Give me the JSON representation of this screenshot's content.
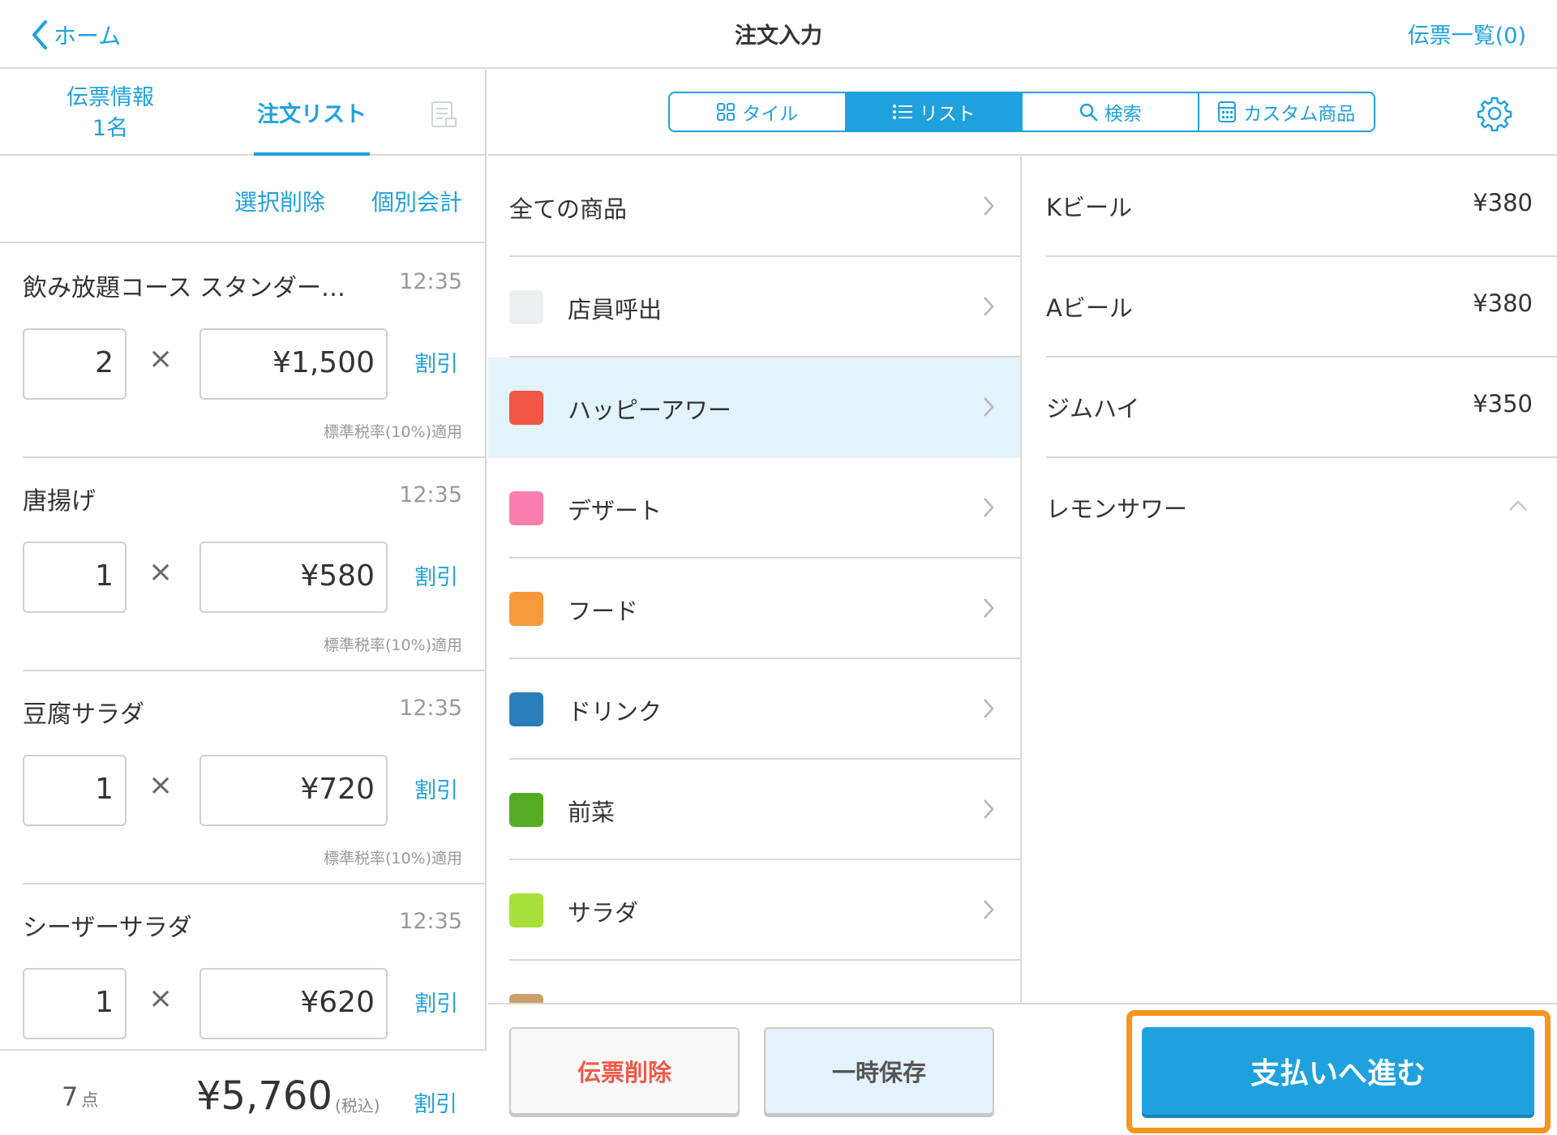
{
  "header": {
    "back_label": "ホーム",
    "title": "注文入力",
    "slip_list_label": "伝票一覧(0)"
  },
  "left_tabs": {
    "slip_info_label": "伝票情報",
    "slip_info_guests": "1名",
    "order_list_label": "注文リスト"
  },
  "left_actions": {
    "bulk_delete_label": "選択削除",
    "split_pay_label": "個別会計"
  },
  "orders": [
    {
      "name": "飲み放題コース スタンダー…",
      "time": "12:35",
      "qty": "2",
      "price": "¥1,500",
      "discount": "割引",
      "tax": "標準税率(10%)適用"
    },
    {
      "name": "唐揚げ",
      "time": "12:35",
      "qty": "1",
      "price": "¥580",
      "discount": "割引",
      "tax": "標準税率(10%)適用"
    },
    {
      "name": "豆腐サラダ",
      "time": "12:35",
      "qty": "1",
      "price": "¥720",
      "discount": "割引",
      "tax": "標準税率(10%)適用"
    },
    {
      "name": "シーザーサラダ",
      "time": "12:35",
      "qty": "1",
      "price": "¥620",
      "discount": "割引",
      "tax": ""
    }
  ],
  "multiply_sign": "×",
  "footer": {
    "count": "7",
    "count_unit": "点",
    "total": "¥5,760",
    "tax_note": "(税込)",
    "discount_label": "割引"
  },
  "segments": [
    {
      "label": "タイル",
      "icon": "tile-grid-icon",
      "active": false
    },
    {
      "label": "リスト",
      "icon": "list-icon",
      "active": true
    },
    {
      "label": "検索",
      "icon": "search-icon",
      "active": false
    },
    {
      "label": "カスタム商品",
      "icon": "calculator-icon",
      "active": false
    }
  ],
  "categories": [
    {
      "label": "全ての商品",
      "color": null,
      "selected": false
    },
    {
      "label": "店員呼出",
      "color": "#eceff0",
      "selected": false
    },
    {
      "label": "ハッピーアワー",
      "color": "#f05545",
      "selected": true
    },
    {
      "label": "デザート",
      "color": "#f980ae",
      "selected": false
    },
    {
      "label": "フード",
      "color": "#f7993a",
      "selected": false
    },
    {
      "label": "ドリンク",
      "color": "#2a7fba",
      "selected": false
    },
    {
      "label": "前菜",
      "color": "#57ab24",
      "selected": false
    },
    {
      "label": "サラダ",
      "color": "#a8e03a",
      "selected": false
    },
    {
      "label": "",
      "color": "#c9a06b",
      "selected": false
    }
  ],
  "products": [
    {
      "name": "Kビール",
      "price": "¥380"
    },
    {
      "name": "Aビール",
      "price": "¥380"
    },
    {
      "name": "ジムハイ",
      "price": "¥350"
    },
    {
      "name": "レモンサワー",
      "price": ""
    }
  ],
  "bottom_actions": {
    "delete_slip_label": "伝票削除",
    "temp_save_label": "一時保存",
    "pay_label": "支払いへ進む"
  },
  "colors": {
    "accent": "#1fa1dd",
    "highlight": "#f7941d",
    "danger": "#ef5a4a",
    "selected_row": "#e2f3fc"
  }
}
